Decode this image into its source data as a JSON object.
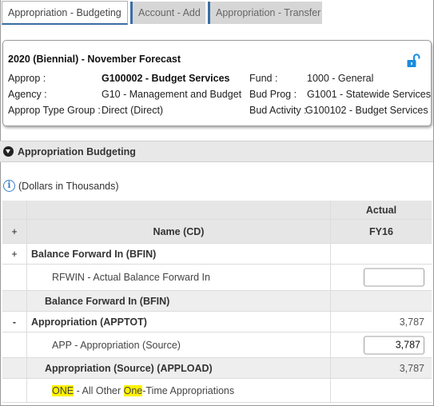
{
  "tabs": [
    {
      "label": "Appropriation - Budgeting",
      "active": true
    },
    {
      "label": "Account - Add",
      "active": false
    },
    {
      "label": "Appropriation - Transfer",
      "active": false
    }
  ],
  "header": {
    "title": "2020 (Biennial) - November Forecast",
    "lock_icon": "unlocked-padlock-icon",
    "approp_label": "Approp :",
    "approp_value": "G100002 - Budget Services",
    "agency_label": "Agency :",
    "agency_value": "G10 - Management and Budget",
    "type_group_label": "Approp Type Group :",
    "type_group_value": "Direct (Direct)",
    "fund_label": "Fund :",
    "fund_value": "1000 - General",
    "bud_prog_label": "Bud Prog :",
    "bud_prog_value": "G1001 - Statewide Services",
    "bud_activity_label": "Bud Activity :",
    "bud_activity_value": "G100102 - Budget Services"
  },
  "section": {
    "title": "Appropriation Budgeting"
  },
  "info_text": "(Dollars in Thousands)",
  "grid": {
    "header_row1": {
      "value_col": "Actual"
    },
    "header_row2": {
      "toggle": "+",
      "name_col": "Name (CD)",
      "value_col": "FY16"
    },
    "rows": [
      {
        "toggle": "+",
        "name": "Balance Forward In (BFIN)",
        "value": ""
      },
      {
        "toggle": "",
        "name": "RFWIN - Actual Balance Forward In",
        "input_value": ""
      },
      {
        "toggle": "",
        "name": "Balance Forward In (BFIN)",
        "value": ""
      },
      {
        "toggle": "-",
        "name": "Appropriation (APPTOT)",
        "value": "3,787"
      },
      {
        "toggle": "",
        "name": "APP - Appropriation (Source)",
        "input_value": "3,787"
      },
      {
        "toggle": "",
        "name": "Appropriation (Source) (APPLOAD)",
        "value": "3,787"
      },
      {
        "toggle": "",
        "name_hl1": "ONE",
        "name_mid": " - All Other ",
        "name_hl2": "One",
        "name_end": "-Time Appropriations"
      }
    ]
  },
  "colors": {
    "tab_accent": "#3a6ea5",
    "highlight": "#fff200",
    "info_blue": "#3a7fc4"
  }
}
